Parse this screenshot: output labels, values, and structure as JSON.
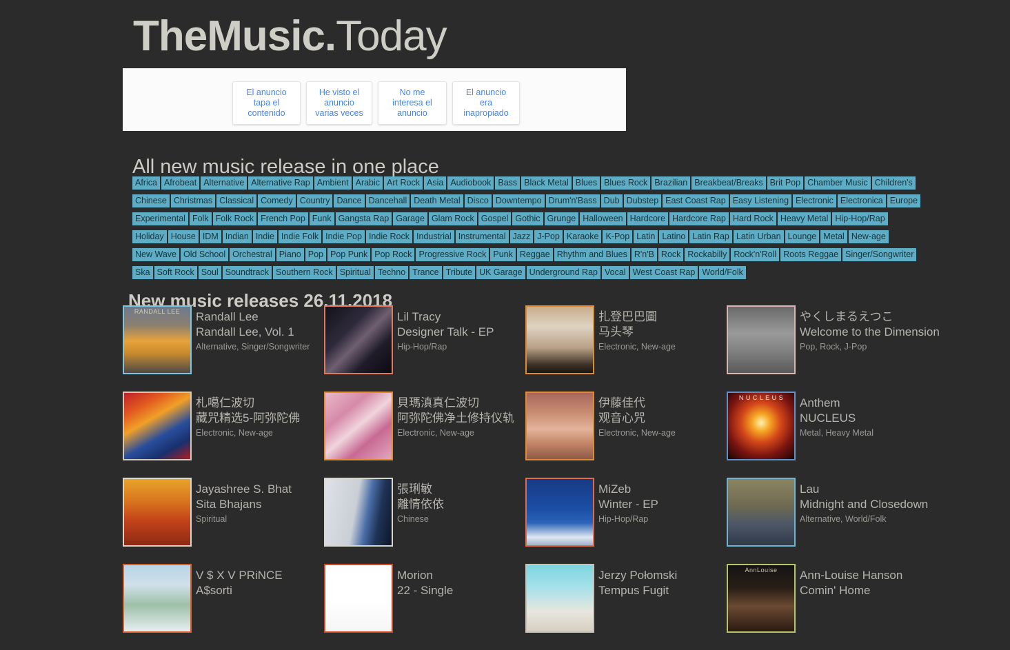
{
  "site": {
    "brand": "TheMusic.",
    "tld": "Today"
  },
  "ad_panel": {
    "buttons": [
      {
        "label": "El anuncio tapa el contenido",
        "name": "ad-covers-content-button"
      },
      {
        "label": "He visto el anuncio varias veces",
        "name": "ad-seen-many-times-button"
      },
      {
        "label": "No me interesa el anuncio",
        "name": "ad-not-interested-button"
      },
      {
        "label": "El anuncio era inapropiado",
        "name": "ad-inappropriate-button"
      }
    ]
  },
  "tagline": "All new music release in one place",
  "genres": [
    "Africa",
    "Afrobeat",
    "Alternative",
    "Alternative Rap",
    "Ambient",
    "Arabic",
    "Art Rock",
    "Asia",
    "Audiobook",
    "Bass",
    "Black Metal",
    "Blues",
    "Blues Rock",
    "Brazilian",
    "Breakbeat/Breaks",
    "Brit Pop",
    "Chamber Music",
    "Children's",
    "Chinese",
    "Christmas",
    "Classical",
    "Comedy",
    "Country",
    "Dance",
    "Dancehall",
    "Death Metal",
    "Disco",
    "Downtempo",
    "Drum'n'Bass",
    "Dub",
    "Dubstep",
    "East Coast Rap",
    "Easy Listening",
    "Electronic",
    "Electronica",
    "Europe",
    "Experimental",
    "Folk",
    "Folk Rock",
    "French Pop",
    "Funk",
    "Gangsta Rap",
    "Garage",
    "Glam Rock",
    "Gospel",
    "Gothic",
    "Grunge",
    "Halloween",
    "Hardcore",
    "Hardcore Rap",
    "Hard Rock",
    "Heavy Metal",
    "Hip-Hop/Rap",
    "Holiday",
    "House",
    "IDM",
    "Indian",
    "Indie",
    "Indie Folk",
    "Indie Pop",
    "Indie Rock",
    "Industrial",
    "Instrumental",
    "Jazz",
    "J-Pop",
    "Karaoke",
    "K-Pop",
    "Latin",
    "Latino",
    "Latin Rap",
    "Latin Urban",
    "Lounge",
    "Metal",
    "New-age",
    "New Wave",
    "Old School",
    "Orchestral",
    "Piano",
    "Pop",
    "Pop Punk",
    "Pop Rock",
    "Progressive Rock",
    "Punk",
    "Reggae",
    "Rhythm and Blues",
    "R'n'B",
    "Rock",
    "Rockabilly",
    "Rock'n'Roll",
    "Roots Reggae",
    "Singer/Songwriter",
    "Ska",
    "Soft Rock",
    "Soul",
    "Soundtrack",
    "Southern Rock",
    "Spiritual",
    "Techno",
    "Trance",
    "Tribute",
    "UK Garage",
    "Underground Rap",
    "Vocal",
    "West Coast Rap",
    "World/Folk"
  ],
  "releases_heading": "New music releases 26.11.2018",
  "releases": [
    {
      "artist": "Randall Lee",
      "album": "Randall Lee, Vol. 1",
      "genres": "Alternative, Singer/Songwriter",
      "cover": {
        "border": "#7cc6e0",
        "bg": "linear-gradient(#6f7a8c 0%,#8a8070 28%,#e8a33a 52%,#c98b2d 70%,#4e4a48 100%)",
        "top_text": "RANDALL LEE",
        "top_text_color": "#d8cdb0"
      }
    },
    {
      "artist": "Lil Tracy",
      "album": "Designer Talk - EP",
      "genres": "Hip-Hop/Rap",
      "cover": {
        "border": "#e07a5a",
        "bg": "linear-gradient(135deg,#13121a 0%,#2e2a3c 35%,#6f6070 52%,#201c2a 72%,#0b0a10 100%)",
        "top_text": "",
        "top_text_color": "#888"
      }
    },
    {
      "artist": "扎登巴巴圖",
      "album": "马头琴",
      "genres": "Electronic, New-age",
      "cover": {
        "border": "#e08a33",
        "bg": "linear-gradient(#c9ad8c 0%,#ded3c2 30%,#b9a187 62%,#3b3026 88%,#1d1712 100%)",
        "top_text": "",
        "top_text_color": "#8c5a2a"
      }
    },
    {
      "artist": "やくしまるえつこ",
      "album": "Welcome to the Dimension",
      "genres": "Pop, Rock, J-Pop",
      "cover": {
        "border": "#d8b5ae",
        "bg": "linear-gradient(#6a6a6a 0%,#9a9a9a 40%,#7d7d7d 70%,#5a5a5a 100%)",
        "top_text": "",
        "top_text_color": "#bbb"
      }
    },
    {
      "artist": "札噶仁波切",
      "album": "藏咒精选5-阿弥陀佛",
      "genres": "Electronic, New-age",
      "cover": {
        "border": "#d3c9bb",
        "bg": "linear-gradient(150deg,#c0202a 0%,#e2591f 22%,#f0a028 40%,#2a4e9c 62%,#18306e 80%,#b31a20 100%)",
        "top_text": "",
        "top_text_color": "#ffe"
      }
    },
    {
      "artist": "貝瑪滇真仁波切",
      "album": "阿弥陀佛净土修持仪轨",
      "genres": "Electronic, New-age",
      "cover": {
        "border": "#e08a33",
        "bg": "linear-gradient(140deg,#e9b8c8 0%,#d68aa8 30%,#f0d4dd 50%,#c76a93 70%,#e3a6bd 100%)",
        "top_text": "",
        "top_text_color": "#fff"
      }
    },
    {
      "artist": "伊藤佳代",
      "album": "观音心咒",
      "genres": "Electronic, New-age",
      "cover": {
        "border": "#e08a33",
        "bg": "linear-gradient(#a8665c 0%,#c98d72 30%,#e3b39a 55%,#c08264 78%,#8e5a4a 100%)",
        "top_text": "",
        "top_text_color": "#fff"
      }
    },
    {
      "artist": "Anthem",
      "album": "NUCLEUS",
      "genres": "Metal, Heavy Metal",
      "cover": {
        "border": "#5d93c9",
        "bg": "radial-gradient(circle at 50% 45%, #fff3b0 0%, #f5a623 18%, #d4481a 40%, #7a1410 68%, #180505 100%)",
        "top_text": "N U C L E U S",
        "top_text_color": "#e8e8e8"
      }
    },
    {
      "artist": "Jayashree S. Bhat",
      "album": "Sita Bhajans",
      "genres": "Spiritual",
      "cover": {
        "border": "#dad6cc",
        "bg": "linear-gradient(#e8a32a 0%,#d8731e 35%,#c4431a 62%,#8d2a14 100%)",
        "top_text": "",
        "top_text_color": "#fff"
      }
    },
    {
      "artist": "張琍敏",
      "album": "離情依依",
      "genres": "Chinese",
      "cover": {
        "border": "#dad6cc",
        "bg": "linear-gradient(100deg,#dfe2e6 0%,#c9cfd6 45%,#4b6ea8 62%,#1f3357 78%,#0d1526 100%)",
        "top_text": "",
        "top_text_color": "#fff"
      }
    },
    {
      "artist": "MiZeb",
      "album": "Winter - EP",
      "genres": "Hip-Hop/Rap",
      "cover": {
        "border": "#e06a4a",
        "bg": "linear-gradient(#173a86 0%,#1b4ea3 45%,#2b63b8 66%,#dfe8f2 88%,#9fb4c8 100%)",
        "top_text": "",
        "top_text_color": "#cfe0f0"
      }
    },
    {
      "artist": "Lau",
      "album": "Midnight and Closedown",
      "genres": "Alternative, World/Folk",
      "cover": {
        "border": "#6fb4cf",
        "bg": "linear-gradient(#8c8463 0%,#6f6a52 40%,#4d5768 68%,#2f3a48 100%)",
        "top_text": "",
        "top_text_color": "#e0d8c0"
      }
    },
    {
      "artist": "V $ X V PRiNCE",
      "album": "A$sorti",
      "genres": "",
      "cover": {
        "border": "#d9622f",
        "bg": "linear-gradient(#b9d4e6 0%,#cfe0ea 30%,#9ec0a8 60%,#e6eef2 100%)",
        "top_text": "",
        "top_text_color": "#fff"
      }
    },
    {
      "artist": "Morion",
      "album": "22 - Single",
      "genres": "",
      "cover": {
        "border": "#d04a2a",
        "bg": "linear-gradient(#ffffff 0%,#ffffff 55%,#f5f5f5 100%)",
        "top_text": "",
        "top_text_color": "#a01010"
      }
    },
    {
      "artist": "Jerzy Połomski",
      "album": "Tempus Fugit",
      "genres": "",
      "cover": {
        "border": "#c8c2b4",
        "bg": "linear-gradient(#7fd4e0 0%,#a8e2ea 35%,#e8e6de 70%,#d8cfc2 100%)",
        "top_text": "",
        "top_text_color": "#2b8c3a"
      }
    },
    {
      "artist": "Ann-Louise Hanson",
      "album": "Comin' Home",
      "genres": "",
      "cover": {
        "border": "#b8c46a",
        "bg": "linear-gradient(#141414 0%,#2a1e16 35%,#6b4a33 62%,#2a1a12 100%)",
        "top_text": "AnnLouise",
        "top_text_color": "#d8c0a8"
      }
    }
  ]
}
